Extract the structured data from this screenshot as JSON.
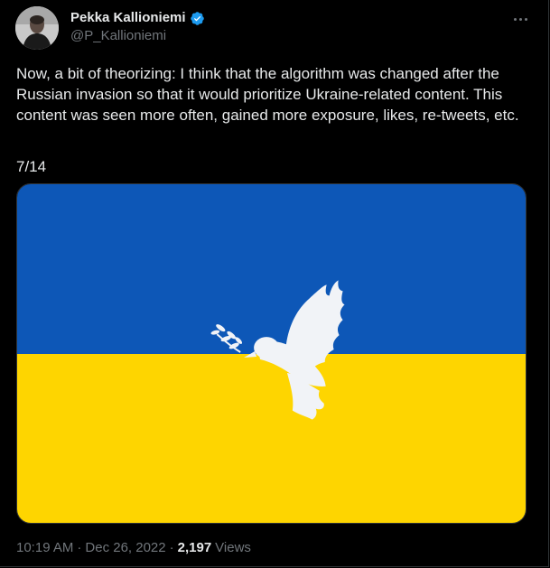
{
  "author": {
    "display_name": "Pekka Kallioniemi",
    "handle": "@P_Kallioniemi",
    "verified": true
  },
  "tweet": {
    "text": "Now, a bit of theorizing: I think that the algorithm was changed after the Russian invasion so that it would prioritize Ukraine-related content. This content was seen more often, gained more exposure, likes, re-tweets, etc.",
    "thread_counter": "7/14"
  },
  "media": {
    "description_colors": {
      "flag_blue": "#0d57b7",
      "flag_yellow": "#fed500",
      "dove": "#f1f3f7"
    },
    "icon": "peace-dove-icon"
  },
  "meta": {
    "time": "10:19 AM",
    "separator": "·",
    "date": "Dec 26, 2022",
    "views_count": "2,197",
    "views_label": "Views"
  },
  "colors": {
    "background": "#000000",
    "text": "#e7e9ea",
    "secondary_text": "#71767b",
    "verified_badge": "#1d9bf0"
  }
}
